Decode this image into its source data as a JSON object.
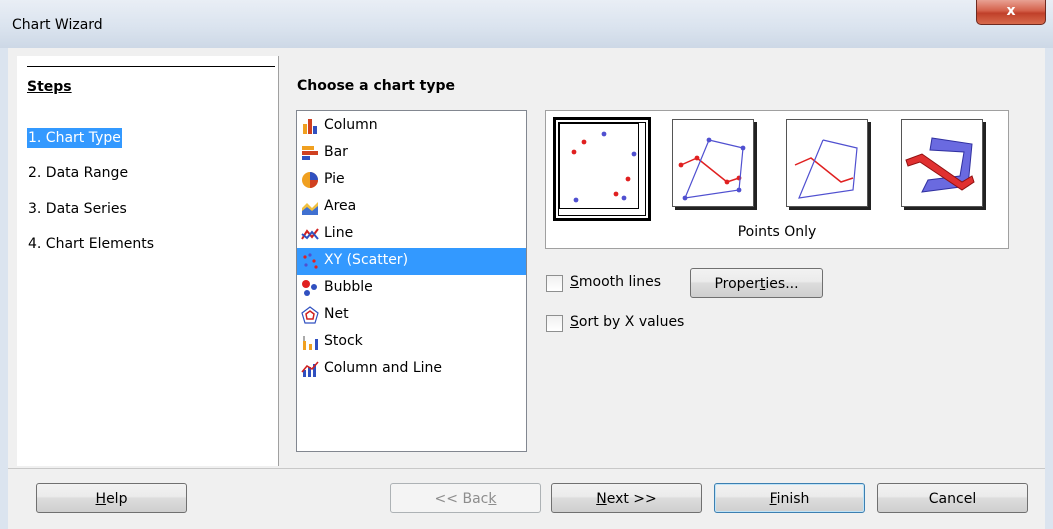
{
  "window": {
    "title": "Chart Wizard",
    "close_label": "x"
  },
  "steps": {
    "title": "Steps",
    "items": [
      {
        "label": "1. Chart Type",
        "selected": true
      },
      {
        "label": "2. Data Range",
        "selected": false
      },
      {
        "label": "3. Data Series",
        "selected": false
      },
      {
        "label": "4. Chart Elements",
        "selected": false
      }
    ]
  },
  "main": {
    "section_title": "Choose a chart type",
    "chart_types": [
      {
        "label": "Column",
        "icon": "column-chart-icon"
      },
      {
        "label": "Bar",
        "icon": "bar-chart-icon"
      },
      {
        "label": "Pie",
        "icon": "pie-chart-icon"
      },
      {
        "label": "Area",
        "icon": "area-chart-icon"
      },
      {
        "label": "Line",
        "icon": "line-chart-icon"
      },
      {
        "label": "XY (Scatter)",
        "icon": "scatter-chart-icon",
        "selected": true
      },
      {
        "label": "Bubble",
        "icon": "bubble-chart-icon"
      },
      {
        "label": "Net",
        "icon": "net-chart-icon"
      },
      {
        "label": "Stock",
        "icon": "stock-chart-icon"
      },
      {
        "label": "Column and Line",
        "icon": "column-and-line-chart-icon"
      }
    ],
    "variants": [
      {
        "icon": "points-only-icon",
        "selected": true
      },
      {
        "icon": "points-and-lines-icon"
      },
      {
        "icon": "lines-only-icon"
      },
      {
        "icon": "3d-lines-icon"
      }
    ],
    "variant_name": "Points Only",
    "options": {
      "smooth_lines": {
        "label_pre": "",
        "label_key": "S",
        "label_post": "mooth lines",
        "checked": false
      },
      "properties_button": {
        "label_pre": "Proper",
        "label_key": "t",
        "label_post": "ies..."
      },
      "sort_by_x": {
        "label_pre": "",
        "label_key": "S",
        "label_post": "ort by X values",
        "checked": false
      }
    }
  },
  "buttons": {
    "help": {
      "pre": "",
      "key": "H",
      "post": "elp"
    },
    "back": {
      "pre": "<< Bac",
      "key": "k",
      "post": ""
    },
    "next": {
      "pre": "",
      "key": "N",
      "post": "ext >>"
    },
    "finish": {
      "pre": "",
      "key": "F",
      "post": "inish"
    },
    "cancel": {
      "pre": "Cancel",
      "key": "",
      "post": ""
    }
  },
  "colors": {
    "selection": "#3399ff",
    "accent_red": "#e02020",
    "accent_blue": "#5050d0"
  }
}
